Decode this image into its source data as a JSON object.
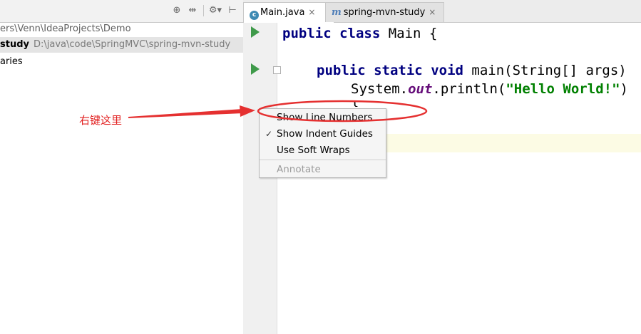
{
  "project_panel": {
    "path_row": "ers\\Venn\\IdeaProjects\\Demo",
    "module_name": "study",
    "module_path": "D:\\java\\code\\SpringMVC\\spring-mvn-study",
    "libraries_row": "aries",
    "toolbar_icons": [
      "target-icon",
      "collapse-icon",
      "gear-icon",
      "pin-icon"
    ]
  },
  "tabs": [
    {
      "label": "Main.java",
      "icon": "java-class-icon",
      "active": true
    },
    {
      "label": "spring-mvn-study",
      "icon": "maven-icon",
      "active": false
    }
  ],
  "code": {
    "line1": {
      "kw1": "public",
      "kw2": "class",
      "rest": " Main {"
    },
    "line2": {
      "kw1": "public",
      "kw2": "static",
      "kw3": "void",
      "rest": " main(String[] args)"
    },
    "line3": {
      "pre": "System.",
      "field": "out",
      "mid": ".println(",
      "str": "\"Hello World!\"",
      "post": ")"
    },
    "line4": "}"
  },
  "context_menu": {
    "items": [
      {
        "label": "Show Line Numbers",
        "checked": false,
        "enabled": true
      },
      {
        "label": "Show Indent Guides",
        "checked": true,
        "enabled": true
      },
      {
        "label": "Use Soft Wraps",
        "checked": false,
        "enabled": true
      },
      {
        "label": "Annotate",
        "checked": false,
        "enabled": false
      }
    ],
    "check_mark": "✓"
  },
  "annotation": {
    "text": "右键这里",
    "color": "#e22020"
  },
  "colors": {
    "keyword": "#000080",
    "string": "#008000",
    "field": "#660e7a",
    "run_icon": "#3f9a4a"
  }
}
